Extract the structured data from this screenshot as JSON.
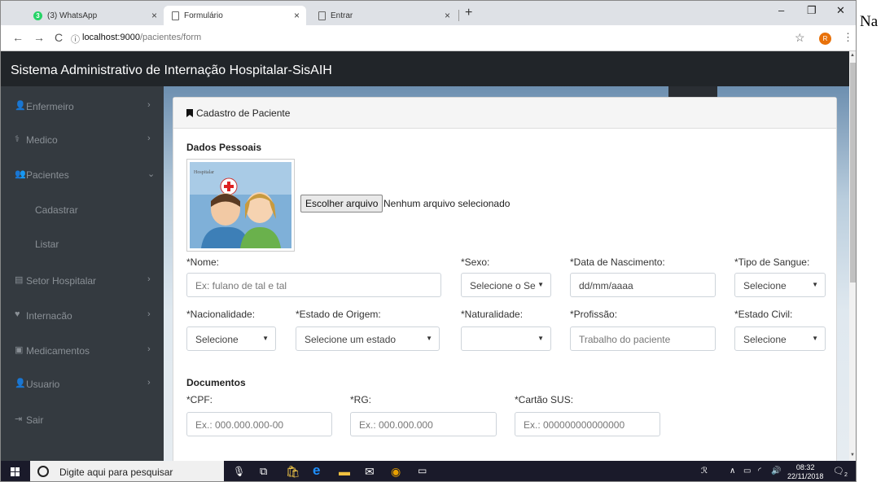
{
  "browser": {
    "tabs": [
      {
        "title": "(3) WhatsApp",
        "icon": "whatsapp-icon"
      },
      {
        "title": "Formulário",
        "icon": "page-icon"
      },
      {
        "title": "Entrar",
        "icon": "page-icon"
      }
    ],
    "url_host": "localhost:9000",
    "url_path": "/pacientes/form",
    "profile_initial": "R"
  },
  "side_note": "Na",
  "app": {
    "title": "Sistema Administrativo de Internação Hospitalar-SisAIH"
  },
  "sidebar": {
    "items": [
      {
        "label": "Enfermeiro",
        "icon": "user-icon"
      },
      {
        "label": "Medico",
        "icon": "doctor-icon"
      },
      {
        "label": "Pacientes",
        "icon": "users-icon"
      },
      {
        "label": "Setor Hospitalar",
        "icon": "building-icon"
      },
      {
        "label": "Internacão",
        "icon": "heartbeat-icon"
      },
      {
        "label": "Medicamentos",
        "icon": "medkit-icon"
      },
      {
        "label": "Usuario",
        "icon": "user-icon"
      },
      {
        "label": "Sair",
        "icon": "sign-out-icon"
      }
    ],
    "subitems": [
      "Cadastrar",
      "Listar"
    ]
  },
  "form": {
    "card_title": "Cadastro de Paciente",
    "section_personal": "Dados Pessoais",
    "file_button": "Escolher arquivo",
    "file_status": "Nenhum arquivo selecionado",
    "labels": {
      "nome": "*Nome:",
      "sexo": "*Sexo:",
      "nascimento": "*Data de Nascimento:",
      "sangue": "*Tipo de Sangue:",
      "nacionalidade": "*Nacionalidade:",
      "estado": "*Estado de Origem:",
      "naturalidade": "*Naturalidade:",
      "profissao": "*Profissão:",
      "civil": "*Estado Civil:"
    },
    "values": {
      "nome_placeholder": "Ex: fulano de tal e tal",
      "sexo": "Selecione o Se",
      "nascimento": "dd/mm/aaaa",
      "sangue": "Selecione",
      "nacionalidade": "Selecione",
      "estado": "Selecione um estado",
      "naturalidade": "",
      "profissao_placeholder": "Trabalho do paciente",
      "civil": "Selecione"
    },
    "section_docs": "Documentos",
    "docs": {
      "cpf_label": "*CPF:",
      "rg_label": "*RG:",
      "sus_label": "*Cartão SUS:",
      "cpf_placeholder": "Ex.: 000.000.000-00",
      "rg_placeholder": "Ex.: 000.000.000",
      "sus_placeholder": "Ex.: 000000000000000"
    }
  },
  "taskbar": {
    "search_placeholder": "Digite aqui para pesquisar",
    "time": "08:32",
    "date": "22/11/2018",
    "notifications": "2"
  }
}
